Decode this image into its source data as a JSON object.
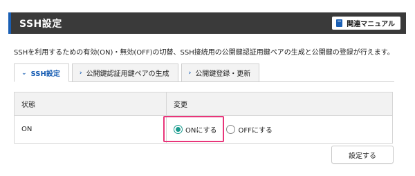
{
  "header": {
    "title": "SSH設定",
    "manual_label": "関連マニュアル",
    "accent_color": "#1a5fb4"
  },
  "description": "SSHを利用するための有効(ON)・無効(OFF)の切替、SSH接続用の公開鍵認証用鍵ペアの生成と公開鍵の登録が行えます。",
  "tabs": [
    {
      "label": "SSH設定",
      "active": true,
      "icon": "chevron-down-icon"
    },
    {
      "label": "公開鍵認証用鍵ペアの生成",
      "active": false,
      "icon": "chevron-right-icon"
    },
    {
      "label": "公開鍵登録・更新",
      "active": false,
      "icon": "chevron-right-icon"
    }
  ],
  "table": {
    "headers": [
      "状態",
      "変更"
    ],
    "status_value": "ON",
    "options": [
      {
        "label": "ONにする",
        "checked": true
      },
      {
        "label": "OFFにする",
        "checked": false
      }
    ]
  },
  "submit_label": "設定する",
  "highlight_color": "#e8357a",
  "radio_color": "#1a9b8e"
}
